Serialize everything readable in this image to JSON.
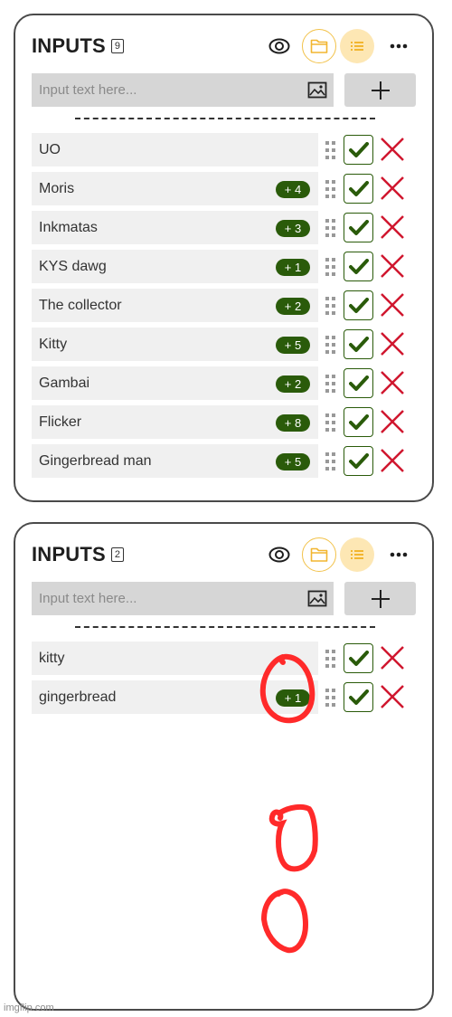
{
  "panels": [
    {
      "title": "INPUTS",
      "count": "9",
      "input": {
        "placeholder": "Input text here...",
        "value": ""
      },
      "items": [
        {
          "label": "UO",
          "badge": null
        },
        {
          "label": "Moris",
          "badge": "+ 4"
        },
        {
          "label": "Inkmatas",
          "badge": "+ 3"
        },
        {
          "label": "KYS dawg",
          "badge": "+ 1"
        },
        {
          "label": "The collector",
          "badge": "+ 2"
        },
        {
          "label": "Kitty",
          "badge": "+ 5"
        },
        {
          "label": "Gambai",
          "badge": "+ 2"
        },
        {
          "label": "Flicker",
          "badge": "+ 8"
        },
        {
          "label": "Gingerbread man",
          "badge": "+ 5"
        }
      ]
    },
    {
      "title": "INPUTS",
      "count": "2",
      "input": {
        "placeholder": "Input text here...",
        "value": ""
      },
      "items": [
        {
          "label": "kitty",
          "badge": null
        },
        {
          "label": "gingerbread",
          "badge": "+ 1"
        }
      ]
    }
  ],
  "icons": {
    "visibility": "eye-icon",
    "folder": "folder-icon",
    "list": "list-icon",
    "more": "more-horizontal-icon",
    "image": "image-icon",
    "add": "plus-icon",
    "drag": "drag-handle-icon",
    "confirm": "check-icon",
    "delete": "close-icon"
  },
  "colors": {
    "accent": "#f2c24a",
    "accent_soft": "#fde7b4",
    "badge": "#2a5b0a",
    "delete": "#d0172f",
    "annotation": "#ff2a2a"
  },
  "watermark": "imgflip.com"
}
